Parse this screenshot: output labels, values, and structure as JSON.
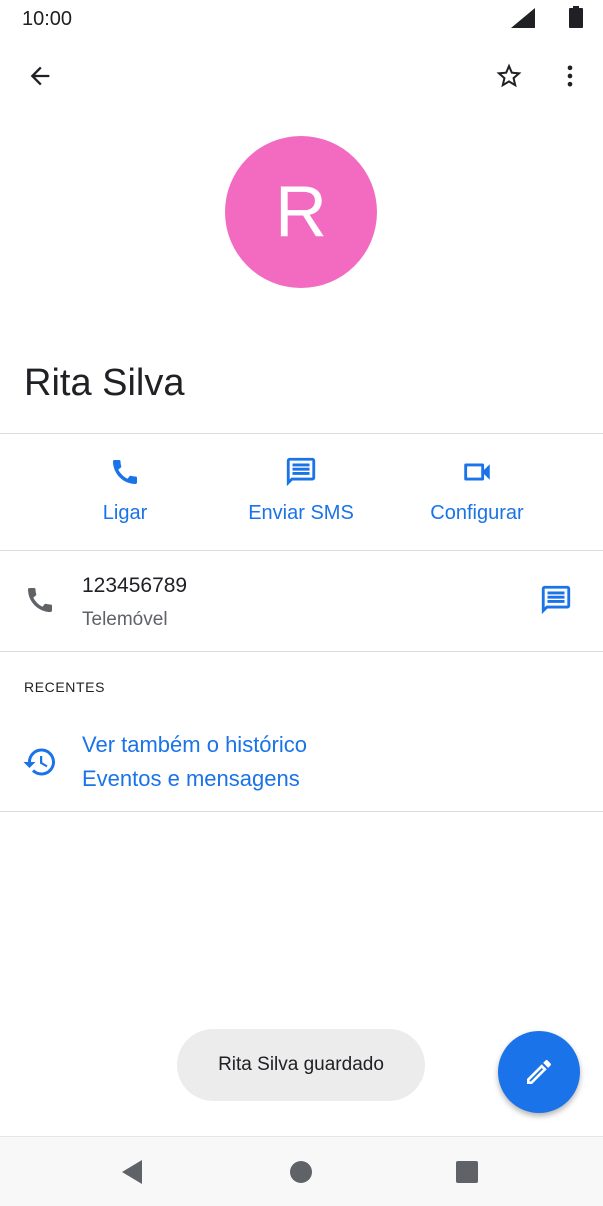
{
  "status_bar": {
    "time": "10:00",
    "signal_icon": "signal-icon",
    "battery_icon": "battery-icon"
  },
  "app_bar": {
    "back_icon": "arrow-back-icon",
    "favorite_icon": "star-outline-icon",
    "more_icon": "more-vert-icon"
  },
  "contact": {
    "initial": "R",
    "avatar_color": "#f36bc1",
    "name": "Rita Silva"
  },
  "actions": [
    {
      "label": "Ligar",
      "icon": "phone-icon"
    },
    {
      "label": "Enviar SMS",
      "icon": "message-icon"
    },
    {
      "label": "Configurar",
      "icon": "videocam-icon"
    }
  ],
  "phone": {
    "number": "123456789",
    "type": "Telemóvel"
  },
  "recents": {
    "header": "RECENTES",
    "line1": "Ver também o histórico",
    "line2": "Eventos e mensagens"
  },
  "toast": {
    "text": "Rita Silva guardado"
  },
  "fab": {
    "icon": "edit-pencil-icon"
  },
  "nav_bar": {
    "back_icon": "nav-back-icon",
    "home_icon": "nav-home-icon",
    "recents_icon": "nav-recents-icon"
  },
  "colors": {
    "accent": "#1a73e8",
    "icon_grey": "#5f6368",
    "divider": "#dadce0"
  }
}
